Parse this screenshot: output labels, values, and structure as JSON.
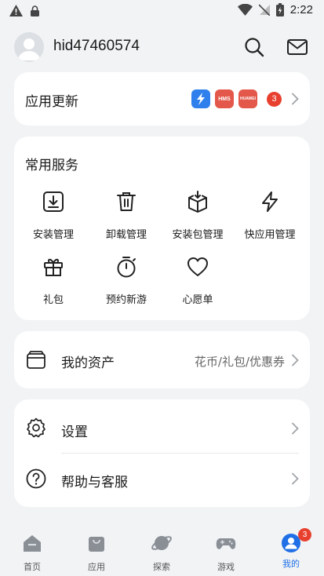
{
  "status_bar": {
    "time": "2:22",
    "icons": [
      "warning-icon",
      "lock-icon",
      "wifi-icon",
      "no-sim-icon",
      "battery-icon"
    ]
  },
  "header": {
    "username": "hid47460574",
    "icons": [
      "search-icon",
      "mail-icon"
    ]
  },
  "updates": {
    "title": "应用更新",
    "apps": [
      {
        "name": "thunder-app-icon",
        "color": "#2f80ed"
      },
      {
        "name": "hms-app-icon",
        "label": "HMS",
        "color": "#e4584b"
      },
      {
        "name": "huawei-app-icon",
        "label": "HUAWEI",
        "color": "#e4584b"
      }
    ],
    "count": "3"
  },
  "services": {
    "title": "常用服务",
    "items": [
      {
        "label": "安装管理",
        "icon": "install-icon"
      },
      {
        "label": "卸载管理",
        "icon": "trash-icon"
      },
      {
        "label": "安装包管理",
        "icon": "package-icon"
      },
      {
        "label": "快应用管理",
        "icon": "quick-app-icon"
      },
      {
        "label": "礼包",
        "icon": "gift-icon"
      },
      {
        "label": "预约新游",
        "icon": "timer-icon"
      },
      {
        "label": "心愿单",
        "icon": "heart-icon"
      }
    ]
  },
  "assets": {
    "label": "我的资产",
    "value": "花币/礼包/优惠券",
    "icon": "wallet-icon"
  },
  "settings": {
    "items": [
      {
        "label": "设置",
        "icon": "gear-icon"
      },
      {
        "label": "帮助与客服",
        "icon": "help-icon"
      }
    ]
  },
  "bottom_nav": {
    "items": [
      {
        "label": "首页",
        "icon": "home-icon"
      },
      {
        "label": "应用",
        "icon": "bag-icon"
      },
      {
        "label": "探索",
        "icon": "planet-icon"
      },
      {
        "label": "游戏",
        "icon": "gamepad-icon"
      },
      {
        "label": "我的",
        "icon": "profile-icon",
        "active": true,
        "badge": "3"
      }
    ]
  },
  "colors": {
    "accent": "#1f6fe6",
    "badge": "#e8402e",
    "background": "#f1f3f5",
    "card": "#ffffff"
  }
}
